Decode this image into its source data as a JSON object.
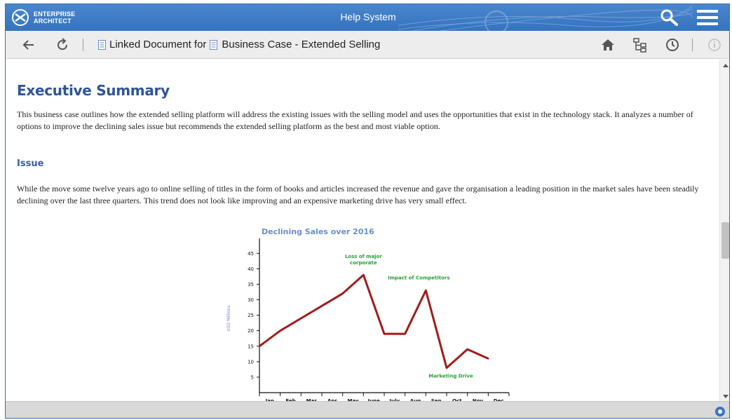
{
  "app": {
    "logo_line1": "ENTERPRISE",
    "logo_line2": "ARCHITECT",
    "title": "Help System"
  },
  "toolbar": {
    "crumb_prefix": "Linked Document for",
    "crumb_target": "Business Case - Extended Selling",
    "icons": [
      "back-arrow-icon",
      "refresh-icon",
      "home-icon",
      "hierarchy-icon",
      "history-icon",
      "info-icon"
    ]
  },
  "content": {
    "heading": "Executive Summary",
    "para1": "This business case outlines how the extended selling platform will address the existing issues with the selling model and uses the opportunities that exist in the technology stack. It analyzes a number of options to improve the declining sales issue but recommends the extended selling platform as the best and most viable option.",
    "subheading": "Issue",
    "para2": "While the move some twelve years ago to online selling of titles in the form of books and articles increased the revenue and gave the organisation a leading position in the market sales have been steadily declining over the last three quarters. This trend does not look like improving and an expensive marketing drive has very small effect."
  },
  "colors": {
    "titlebar": "#3473bf",
    "heading": "#2f5597",
    "line": "#a01c1c",
    "annotation": "#2e9e3a",
    "chart_title": "#6a8fc8"
  },
  "chart_data": {
    "type": "line",
    "title": "Declining Sales over 2016",
    "ylabel": "USD Millions",
    "xlabel": "",
    "categories": [
      "Jan",
      "Feb",
      "Mar",
      "Apr",
      "May",
      "June",
      "July",
      "Aug",
      "Sep",
      "Oct",
      "Nov",
      "Dec"
    ],
    "series": [
      {
        "values": [
          15,
          20,
          24,
          28,
          32,
          38,
          19,
          19,
          33,
          8,
          14,
          11
        ]
      }
    ],
    "yticks": [
      5,
      10,
      15,
      20,
      25,
      30,
      35,
      40,
      45
    ],
    "ylim": [
      0,
      48
    ],
    "grid": false,
    "annotations": [
      {
        "text": "Loss of major corporate",
        "x": "June",
        "y": 38
      },
      {
        "text": "Impact of Competitors",
        "x": "Sep",
        "y": 33
      },
      {
        "text": "Marketing Drive",
        "x": "Oct",
        "y": 8
      }
    ]
  }
}
